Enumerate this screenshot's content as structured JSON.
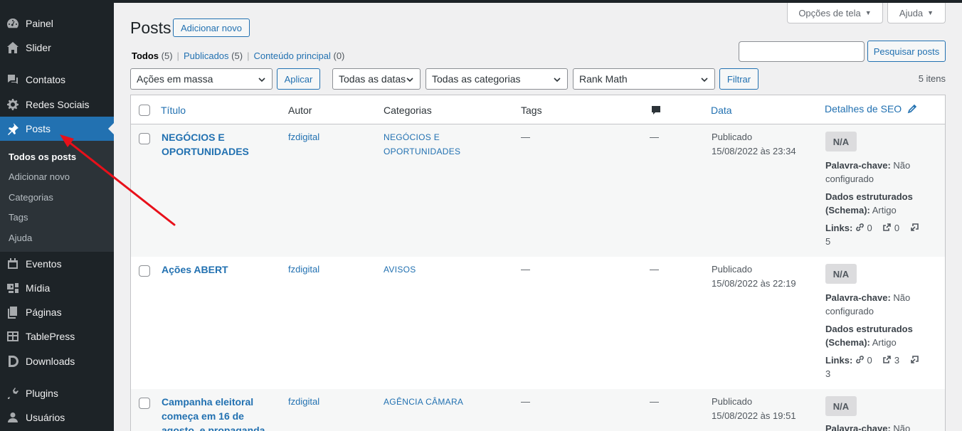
{
  "sidebar": {
    "items": [
      {
        "label": "Painel",
        "icon": "dashboard-icon"
      },
      {
        "label": "Slider",
        "icon": "home-icon"
      },
      {
        "label": "Contatos",
        "icon": "comments-icon"
      },
      {
        "label": "Redes Sociais",
        "icon": "gear-icon"
      },
      {
        "label": "Posts",
        "icon": "pin-icon"
      },
      {
        "label": "Eventos",
        "icon": "calendar-icon"
      },
      {
        "label": "Mídia",
        "icon": "media-icon"
      },
      {
        "label": "Páginas",
        "icon": "pages-icon"
      },
      {
        "label": "TablePress",
        "icon": "table-icon"
      },
      {
        "label": "Downloads",
        "icon": "downloads-icon"
      },
      {
        "label": "Plugins",
        "icon": "plugin-icon"
      },
      {
        "label": "Usuários",
        "icon": "users-icon"
      }
    ],
    "submenu": [
      "Todos os posts",
      "Adicionar novo",
      "Categorias",
      "Tags",
      "Ajuda"
    ]
  },
  "screen_meta": {
    "options": "Opções de tela",
    "help": "Ajuda"
  },
  "header": {
    "title": "Posts",
    "add_new": "Adicionar novo"
  },
  "filters_nav": {
    "all": "Todos",
    "all_count": "(5)",
    "published": "Publicados",
    "published_count": "(5)",
    "main": "Conteúdo principal",
    "main_count": "(0)"
  },
  "search": {
    "button": "Pesquisar posts",
    "value": ""
  },
  "bulk": {
    "selected": "Ações em massa",
    "apply": "Aplicar"
  },
  "filters": {
    "dates": "Todas as datas",
    "categories": "Todas as categorias",
    "rankmath": "Rank Math",
    "filter": "Filtrar"
  },
  "items_count": "5 itens",
  "columns": {
    "title": "Título",
    "author": "Autor",
    "categories": "Categorias",
    "tags": "Tags",
    "date": "Data",
    "seo": "Detalhes de SEO"
  },
  "rows": [
    {
      "title_l1": "NEGÓCIOS E",
      "title_l2": "OPORTUNIDADES",
      "author": "fzdigital",
      "cat_l1": "NEGÓCIOS E",
      "cat_l2": "OPORTUNIDADES",
      "tags": "—",
      "comments": "—",
      "status": "Publicado",
      "date": "15/08/2022 às 23:34",
      "score": "N/A",
      "kw_label": "Palavra-chave:",
      "kw_val1": "Não",
      "kw_val2": "configurado",
      "schema_l1": "Dados estruturados",
      "schema_l2": "(Schema):",
      "schema_val": "Artigo",
      "links_label": "Links:",
      "internal": "0",
      "external": "0",
      "incoming": "5"
    },
    {
      "title_l1": "Ações ABERT",
      "title_l2": "",
      "author": "fzdigital",
      "cat_l1": "AVISOS",
      "cat_l2": "",
      "tags": "—",
      "comments": "—",
      "status": "Publicado",
      "date": "15/08/2022 às 22:19",
      "score": "N/A",
      "kw_label": "Palavra-chave:",
      "kw_val1": "Não",
      "kw_val2": "configurado",
      "schema_l1": "Dados estruturados",
      "schema_l2": "(Schema):",
      "schema_val": "Artigo",
      "links_label": "Links:",
      "internal": "0",
      "external": "3",
      "incoming": "3"
    },
    {
      "title_l1": "Campanha eleitoral",
      "title_l2": "começa em 16 de",
      "title_l3": "agosto, e propaganda",
      "author": "fzdigital",
      "cat_l1": "AGÊNCIA CÂMARA",
      "cat_l2": "",
      "tags": "—",
      "comments": "—",
      "status": "Publicado",
      "date": "15/08/2022 às 19:51",
      "score": "N/A",
      "kw_label": "Palavra-chave:",
      "kw_val1": "Não"
    }
  ],
  "colors": {
    "sidebar": "#1d2327",
    "accent": "#2271b1",
    "annotation": "#e8101a"
  }
}
